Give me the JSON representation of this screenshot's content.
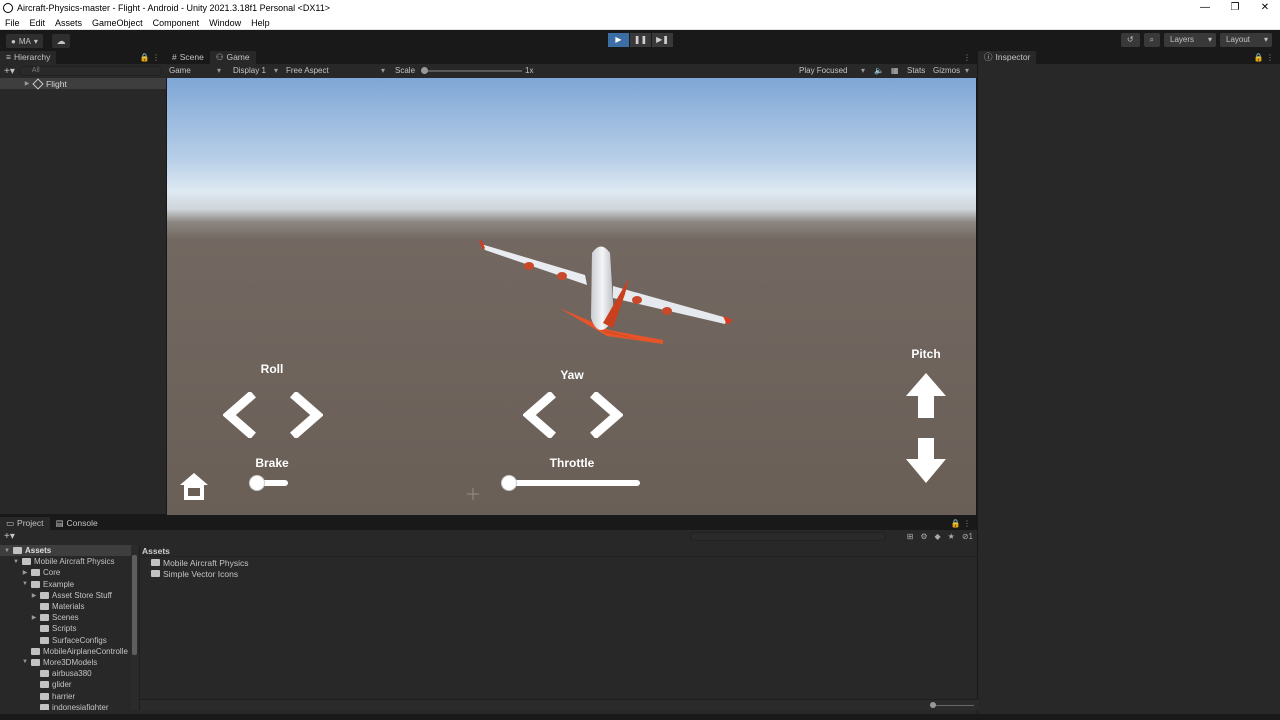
{
  "window": {
    "title": "Aircraft-Physics-master - Flight - Android - Unity 2021.3.18f1 Personal <DX11>",
    "controls": [
      "—",
      "❐",
      "✕"
    ]
  },
  "menu": [
    "File",
    "Edit",
    "Assets",
    "GameObject",
    "Component",
    "Window",
    "Help"
  ],
  "toolbar": {
    "account": "MA",
    "right": {
      "layers": "Layers",
      "layout": "Layout"
    }
  },
  "hierarchy": {
    "tab": "Hierarchy",
    "search_placeholder": "All",
    "root_item": "Flight"
  },
  "game_view": {
    "tabs": [
      "Scene",
      "Game"
    ],
    "toolbar": {
      "mode": "Game",
      "display": "Display 1",
      "aspect": "Free Aspect",
      "scale_label": "Scale",
      "scale_value": "1x",
      "play_focused": "Play Focused",
      "stats": "Stats",
      "gizmos": "Gizmos"
    },
    "hud": {
      "roll": "Roll",
      "yaw": "Yaw",
      "pitch": "Pitch",
      "brake": "Brake",
      "throttle": "Throttle",
      "brake_value": 0.0,
      "throttle_value": 0.0
    }
  },
  "inspector": {
    "tab": "Inspector"
  },
  "project": {
    "tabs": [
      "Project",
      "Console"
    ],
    "tree": [
      {
        "label": "Assets",
        "depth": 0,
        "selected": true,
        "expanded": true
      },
      {
        "label": "Mobile Aircraft Physics",
        "depth": 1,
        "expanded": true
      },
      {
        "label": "Core",
        "depth": 2,
        "expanded": false
      },
      {
        "label": "Example",
        "depth": 2,
        "expanded": true
      },
      {
        "label": "Asset Store Stuff",
        "depth": 3,
        "expanded": false
      },
      {
        "label": "Materials",
        "depth": 3
      },
      {
        "label": "Scenes",
        "depth": 3,
        "expanded": false
      },
      {
        "label": "Scripts",
        "depth": 3
      },
      {
        "label": "SurfaceConfigs",
        "depth": 3
      },
      {
        "label": "MobileAirplaneControlle",
        "depth": 2
      },
      {
        "label": "More3DModels",
        "depth": 2,
        "expanded": true
      },
      {
        "label": "airbusa380",
        "depth": 3
      },
      {
        "label": "glider",
        "depth": 3
      },
      {
        "label": "harrier",
        "depth": 3
      },
      {
        "label": "indonesiafighter",
        "depth": 3
      }
    ],
    "breadcrumb": "Assets",
    "assets": [
      "Mobile Aircraft Physics",
      "Simple Vector Icons"
    ],
    "hidden_count": "1"
  }
}
